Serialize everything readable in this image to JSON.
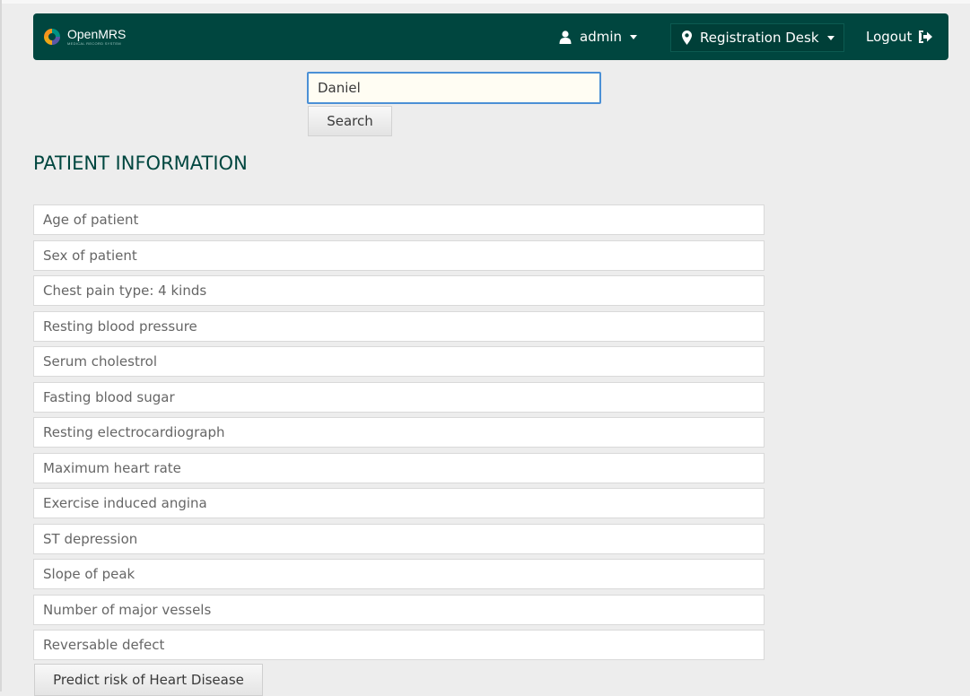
{
  "header": {
    "logo_name": "OpenMRS",
    "logo_tagline": "MEDICAL RECORD SYSTEM",
    "user_label": "admin",
    "location_label": "Registration Desk",
    "logout_label": "Logout",
    "icons": {
      "logo": "openmrs-logo-icon",
      "user": "user-icon",
      "location": "map-marker-icon",
      "logout": "sign-out-icon",
      "caret": "chevron-down-icon"
    }
  },
  "search": {
    "value": "Daniel",
    "button_label": "Search"
  },
  "section_title": "PATIENT INFORMATION",
  "fields": [
    {
      "placeholder": "Age of patient"
    },
    {
      "placeholder": "Sex of patient"
    },
    {
      "placeholder": "Chest pain type: 4 kinds"
    },
    {
      "placeholder": "Resting blood pressure"
    },
    {
      "placeholder": "Serum cholestrol"
    },
    {
      "placeholder": "Fasting blood sugar"
    },
    {
      "placeholder": "Resting electrocardiograph"
    },
    {
      "placeholder": "Maximum heart rate"
    },
    {
      "placeholder": "Exercise induced angina"
    },
    {
      "placeholder": "ST depression"
    },
    {
      "placeholder": "Slope of peak"
    },
    {
      "placeholder": "Number of major vessels"
    },
    {
      "placeholder": "Reversable defect"
    }
  ],
  "predict_button_label": "Predict risk of Heart Disease",
  "colors": {
    "header_bg": "#00463f",
    "page_bg": "#ededed",
    "input_focus_border": "#4b90d6",
    "title": "#00463f",
    "logo_orange": "#f7941d",
    "logo_teal": "#009384",
    "logo_purple": "#5b57a6",
    "logo_yellow": "#eea616"
  }
}
